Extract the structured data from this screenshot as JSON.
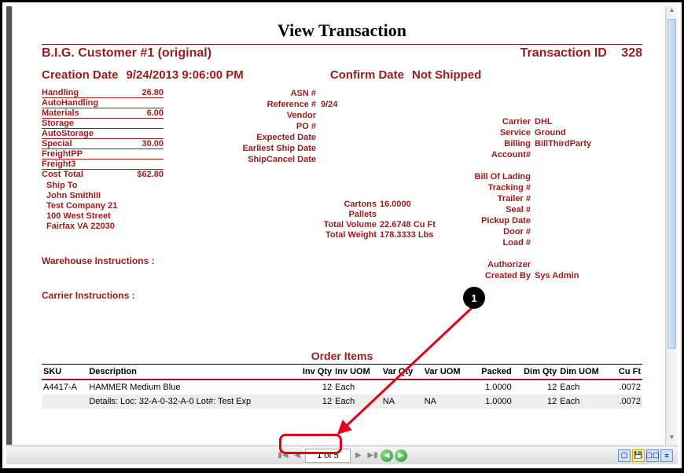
{
  "doc": {
    "title": "View Transaction"
  },
  "customer": {
    "name": "B.I.G. Customer #1 (original)",
    "transaction_id_label": "Transaction ID",
    "transaction_id": "328"
  },
  "creation": {
    "label": "Creation Date",
    "value": "9/24/2013 9:06:00 PM"
  },
  "confirm": {
    "label": "Confirm Date",
    "value": "Not Shipped"
  },
  "costs": {
    "handling": {
      "label": "Handling",
      "value": "26.80"
    },
    "autohandling": {
      "label": "AutoHandling",
      "value": ""
    },
    "materials": {
      "label": "Materials",
      "value": "6.00"
    },
    "storage": {
      "label": "Storage",
      "value": ""
    },
    "autostorage": {
      "label": "AutoStorage",
      "value": ""
    },
    "special": {
      "label": "Special",
      "value": "30.00"
    },
    "freightpp": {
      "label": "FreightPP",
      "value": ""
    },
    "freight3": {
      "label": "Freight3",
      "value": ""
    },
    "total": {
      "label": "Cost Total",
      "value": "$62.80"
    }
  },
  "mid": {
    "asn": "ASN #",
    "reference": "Reference #",
    "reference_val": "9/24",
    "vendor": "Vendor",
    "po": "PO #",
    "expected": "Expected Date",
    "earliest": "Earliest Ship Date",
    "cancel": "ShipCancel Date"
  },
  "shipto": {
    "label": "Ship To",
    "name": "John SmithIII",
    "company": "Test Company 21",
    "street": "100 West Street",
    "citystate": "Fairfax  VA  22030"
  },
  "right": {
    "carrier": {
      "label": "Carrier",
      "value": "DHL"
    },
    "service": {
      "label": "Service",
      "value": "Ground"
    },
    "billing": {
      "label": "Billing",
      "value": "BillThirdParty"
    },
    "account": {
      "label": "Account#",
      "value": ""
    },
    "bol": {
      "label": "Bill Of Lading"
    },
    "tracking": {
      "label": "Tracking #"
    },
    "trailer": {
      "label": "Trailer #"
    },
    "seal": {
      "label": "Seal #"
    },
    "pickup": {
      "label": "Pickup Date"
    },
    "door": {
      "label": "Door #"
    },
    "load": {
      "label": "Load #"
    },
    "authorizer": {
      "label": "Authorizer"
    },
    "createdby": {
      "label": "Created By",
      "value": "Sys Admin"
    }
  },
  "volumes": {
    "cartons": {
      "label": "Cartons",
      "value": "16.0000"
    },
    "pallets": {
      "label": "Pallets",
      "value": ""
    },
    "totalvol": {
      "label": "Total Volume",
      "value": "22.6748 Cu Ft"
    },
    "totalwt": {
      "label": "Total Weight",
      "value": "178.3333 Lbs"
    }
  },
  "instructions": {
    "warehouse": "Warehouse Instructions :",
    "carrier": "Carrier Instructions :"
  },
  "order": {
    "title": "Order Items",
    "headers": {
      "sku": "SKU",
      "desc": "Description",
      "invqty": "Inv Qty",
      "invuom": "Inv UOM",
      "varqty": "Var Qty",
      "varuom": "Var UOM",
      "packed": "Packed",
      "dimqty": "Dim Qty",
      "dimuom": "Dim UOM",
      "cuft": "Cu Ft"
    },
    "rows": [
      {
        "sku": "A4417-A",
        "desc": "HAMMER Medium Blue",
        "invqty": "12",
        "invuom": "Each",
        "varqty": "",
        "varuom": "",
        "packed": "1.0000",
        "dimqty": "12",
        "dimuom": "Each",
        "cuft": ".0072"
      },
      {
        "sku": "",
        "desc": "Details: Loc: 32-A-0-32-A-0 Lot#: Test Exp",
        "invqty": "12",
        "invuom": "Each",
        "varqty": "NA",
        "varuom": "NA",
        "packed": "1.0000",
        "dimqty": "12",
        "dimuom": "Each",
        "cuft": ".0072"
      }
    ]
  },
  "pager": {
    "value": "1 of 5"
  },
  "callout": {
    "num": "1"
  }
}
